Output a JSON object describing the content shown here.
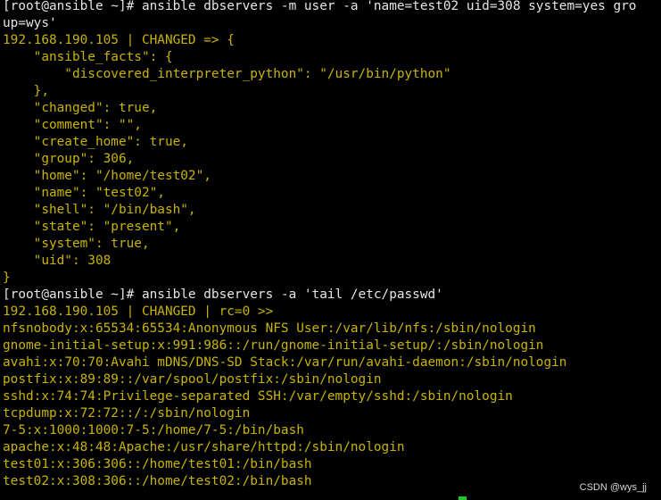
{
  "terminal": {
    "lines": [
      {
        "text": "[root@ansible ~]# ansible dbservers -m user -a 'name=test02 uid=308 system=yes gro",
        "color": "#e6e6e6"
      },
      {
        "text": "up=wys'",
        "color": "#e6e6e6"
      },
      {
        "text": "192.168.190.105 | CHANGED => {",
        "color": "#c8b400"
      },
      {
        "text": "    \"ansible_facts\": {",
        "color": "#c8b400"
      },
      {
        "text": "        \"discovered_interpreter_python\": \"/usr/bin/python\"",
        "color": "#c8b400"
      },
      {
        "text": "    },",
        "color": "#c8b400"
      },
      {
        "text": "    \"changed\": true,",
        "color": "#c8b400"
      },
      {
        "text": "    \"comment\": \"\",",
        "color": "#c8b400"
      },
      {
        "text": "    \"create_home\": true,",
        "color": "#c8b400"
      },
      {
        "text": "    \"group\": 306,",
        "color": "#c8b400"
      },
      {
        "text": "    \"home\": \"/home/test02\",",
        "color": "#c8b400"
      },
      {
        "text": "    \"name\": \"test02\",",
        "color": "#c8b400"
      },
      {
        "text": "    \"shell\": \"/bin/bash\",",
        "color": "#c8b400"
      },
      {
        "text": "    \"state\": \"present\",",
        "color": "#c8b400"
      },
      {
        "text": "    \"system\": true,",
        "color": "#c8b400"
      },
      {
        "text": "    \"uid\": 308",
        "color": "#c8b400"
      },
      {
        "text": "}",
        "color": "#c8b400"
      },
      {
        "text": "[root@ansible ~]# ansible dbservers -a 'tail /etc/passwd'",
        "color": "#e6e6e6"
      },
      {
        "text": "192.168.190.105 | CHANGED | rc=0 >>",
        "color": "#c8b400"
      },
      {
        "text": "nfsnobody:x:65534:65534:Anonymous NFS User:/var/lib/nfs:/sbin/nologin",
        "color": "#c8b400"
      },
      {
        "text": "gnome-initial-setup:x:991:986::/run/gnome-initial-setup/:/sbin/nologin",
        "color": "#c8b400"
      },
      {
        "text": "avahi:x:70:70:Avahi mDNS/DNS-SD Stack:/var/run/avahi-daemon:/sbin/nologin",
        "color": "#c8b400"
      },
      {
        "text": "postfix:x:89:89::/var/spool/postfix:/sbin/nologin",
        "color": "#c8b400"
      },
      {
        "text": "sshd:x:74:74:Privilege-separated SSH:/var/empty/sshd:/sbin/nologin",
        "color": "#c8b400"
      },
      {
        "text": "tcpdump:x:72:72::/:/sbin/nologin",
        "color": "#c8b400"
      },
      {
        "text": "7-5:x:1000:1000:7-5:/home/7-5:/bin/bash",
        "color": "#c8b400"
      },
      {
        "text": "apache:x:48:48:Apache:/usr/share/httpd:/sbin/nologin",
        "color": "#c8b400"
      },
      {
        "text": "test01:x:306:306::/home/test01:/bin/bash",
        "color": "#c8b400"
      },
      {
        "text": "test02:x:308:306::/home/test02:/bin/bash",
        "color": "#c8b400"
      }
    ],
    "background": "#000000",
    "cursor_color": "#22c522"
  },
  "watermark": {
    "text": "CSDN @wys_jj"
  }
}
